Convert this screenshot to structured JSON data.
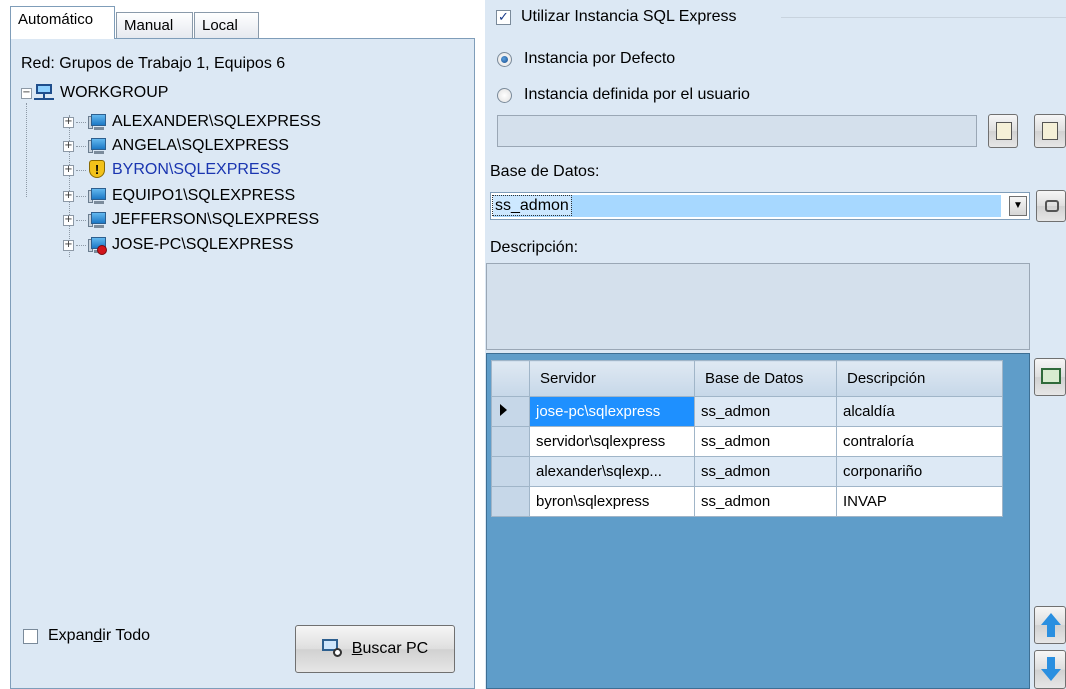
{
  "tabs": [
    "Automático",
    "Manual",
    "Local"
  ],
  "network": {
    "summary": "Red: Grupos de Trabajo 1, Equipos 6",
    "root": "WORKGROUP",
    "servers": [
      {
        "label": "ALEXANDER\\SQLEXPRESS",
        "icon": "computer-icon"
      },
      {
        "label": "ANGELA\\SQLEXPRESS",
        "icon": "computer-icon"
      },
      {
        "label": "BYRON\\SQLEXPRESS",
        "icon": "security-shield-icon"
      },
      {
        "label": "EQUIPO1\\SQLEXPRESS",
        "icon": "computer-icon"
      },
      {
        "label": "JEFFERSON\\SQLEXPRESS",
        "icon": "computer-icon"
      },
      {
        "label": "JOSE-PC\\SQLEXPRESS",
        "icon": "computer-check-icon"
      }
    ]
  },
  "left_footer": {
    "expand_all_prefix": "Expan",
    "expand_all_mnemonic": "d",
    "expand_all_suffix": "ir Todo",
    "search_mnemonic": "B",
    "search_rest": "uscar PC"
  },
  "sql": {
    "use_express_label": "Utilizar Instancia SQL Express",
    "use_express_checked": true,
    "default_instance_label": "Instancia por Defecto",
    "user_instance_label": "Instancia definida por el usuario",
    "instance_value": "",
    "selected_instance": "default"
  },
  "database": {
    "label": "Base de Datos:",
    "selected": "ss_admon"
  },
  "description": {
    "label": "Descripción:",
    "value": ""
  },
  "grid": {
    "columns": [
      "Servidor",
      "Base de Datos",
      "Descripción"
    ],
    "rows": [
      [
        "jose-pc\\sqlexpress",
        "ss_admon",
        "alcaldía"
      ],
      [
        "servidor\\sqlexpress",
        "ss_admon",
        "contraloría"
      ],
      [
        "alexander\\sqlexp...",
        "ss_admon",
        "corponariño"
      ],
      [
        "byron\\sqlexpress",
        "ss_admon",
        "INVAP"
      ]
    ]
  },
  "colors": {
    "panel_bg": "#dce8f4",
    "grid_bg": "#5f9dc9",
    "selection": "#1e90ff"
  }
}
